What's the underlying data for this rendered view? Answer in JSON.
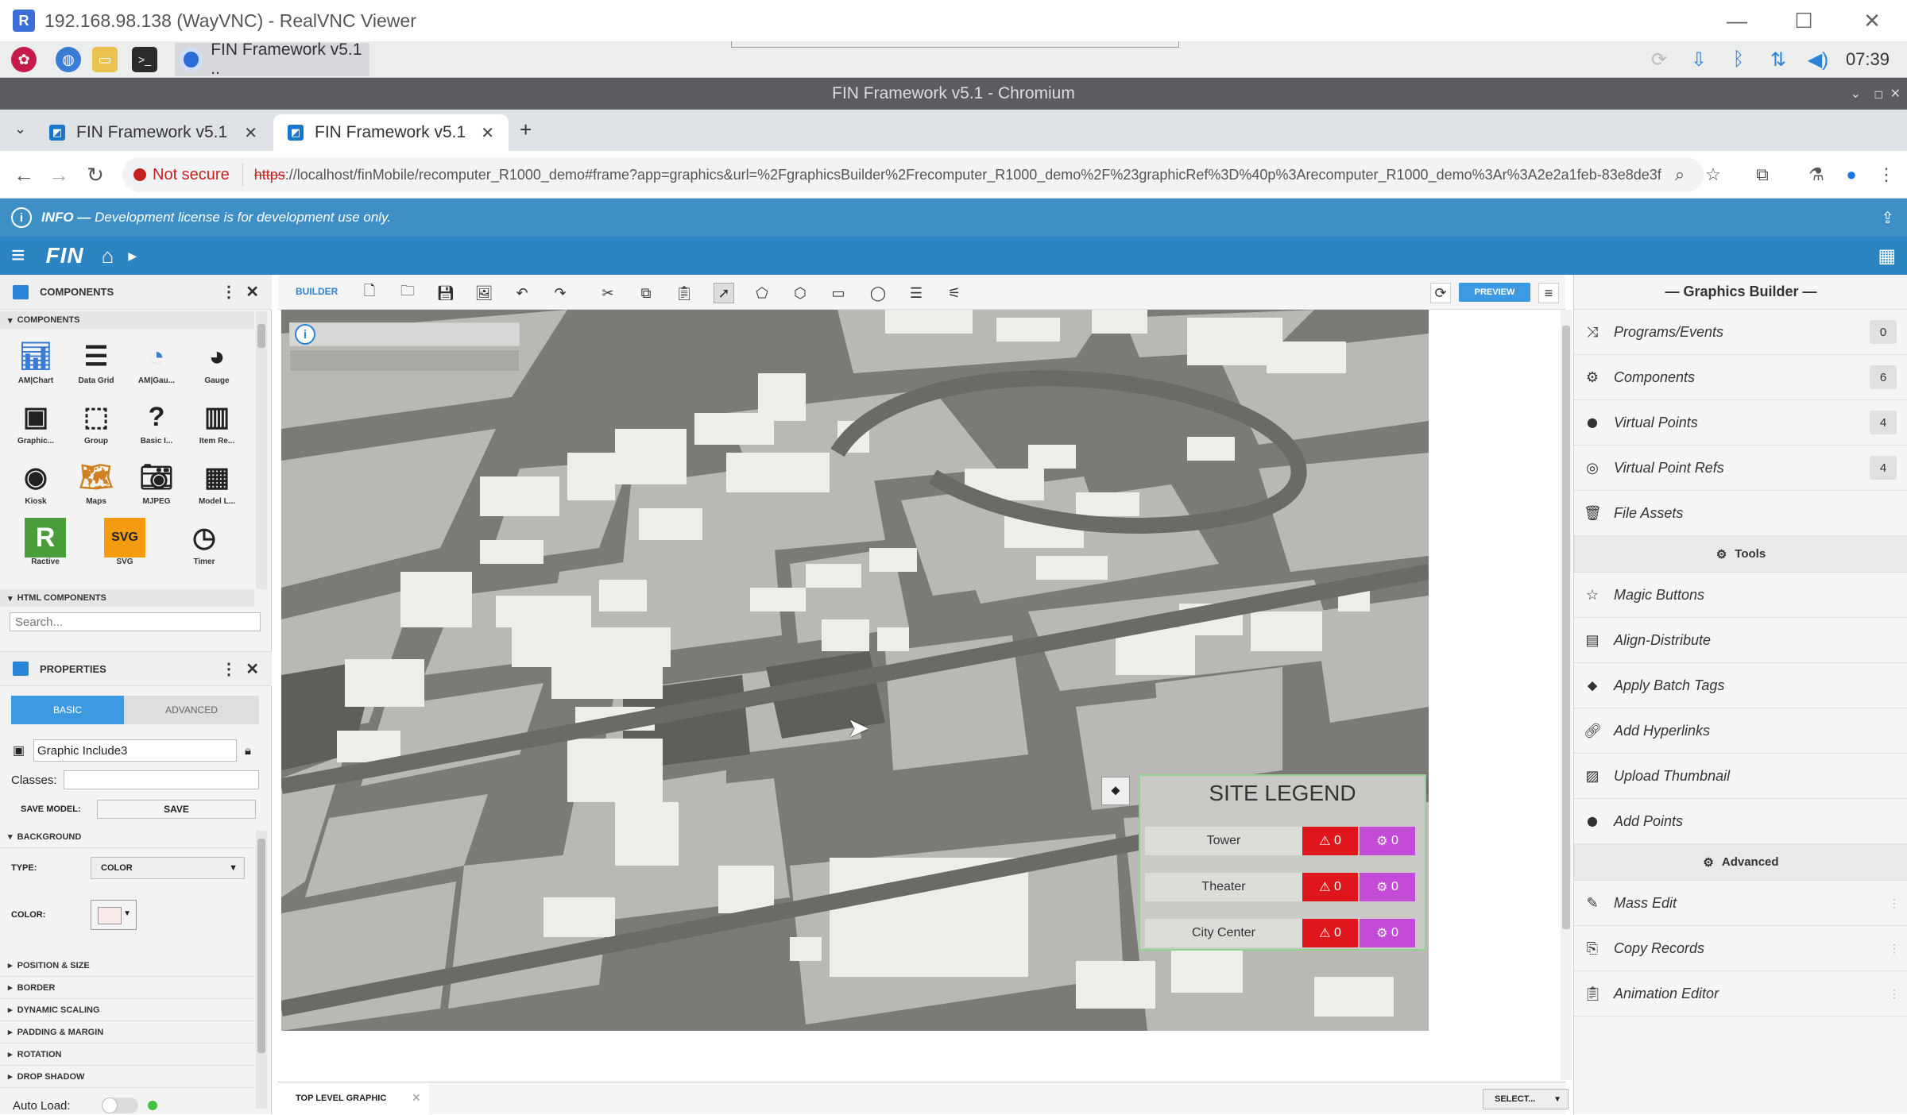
{
  "vnc": {
    "title": "192.168.98.138 (WayVNC) - RealVNC Viewer",
    "logo": "R"
  },
  "taskbar": {
    "task_label": "FIN Framework v5.1 ..",
    "clock": "07:39"
  },
  "chrome": {
    "window_title": "FIN Framework v5.1 - Chromium",
    "tabs": [
      {
        "label": "FIN Framework v5.1"
      },
      {
        "label": "FIN Framework v5.1"
      }
    ],
    "not_secure": "Not secure",
    "url_scheme": "https",
    "url_rest": "://localhost/finMobile/recomputer_R1000_demo#frame?app=graphics&url=%2FgraphicsBuilder%2Frecomputer_R1000_demo%2F%23graphicRef%3D%40p%3Arecomputer_R1000_demo%3Ar%3A2e2a1feb-83e8de3f"
  },
  "infobar": {
    "label": "INFO —",
    "message": "Development license is for development use only."
  },
  "finbar": {
    "brand": "FIN"
  },
  "components_panel": {
    "title": "COMPONENTS",
    "section": "COMPONENTS",
    "items": [
      {
        "label": "AM|Chart",
        "icon": "chart-icon"
      },
      {
        "label": "Data Grid",
        "icon": "grid-icon"
      },
      {
        "label": "AM|Gau...",
        "icon": "amgauge-icon"
      },
      {
        "label": "Gauge",
        "icon": "gauge-icon"
      },
      {
        "label": "Graphic...",
        "icon": "graphic-icon"
      },
      {
        "label": "Group",
        "icon": "group-icon"
      },
      {
        "label": "Basic I...",
        "icon": "help-icon"
      },
      {
        "label": "Item Re...",
        "icon": "item-repeater-icon"
      },
      {
        "label": "Kiosk",
        "icon": "kiosk-icon"
      },
      {
        "label": "Maps",
        "icon": "maps-icon"
      },
      {
        "label": "MJPEG",
        "icon": "camera-icon"
      },
      {
        "label": "Model L...",
        "icon": "model-icon"
      },
      {
        "label": "Ractive",
        "icon": "ractive-icon"
      },
      {
        "label": "SVG",
        "icon": "svg-icon"
      },
      {
        "label": "Timer",
        "icon": "timer-icon"
      }
    ],
    "html_section": "HTML COMPONENTS",
    "search_placeholder": "Search..."
  },
  "properties_panel": {
    "title": "PROPERTIES",
    "tab_basic": "BASIC",
    "tab_advanced": "ADVANCED",
    "name_value": "Graphic Include3",
    "classes_label": "Classes:",
    "save_model_label": "SAVE MODEL:",
    "save_button": "SAVE",
    "background_section": "BACKGROUND",
    "type_label": "TYPE:",
    "type_value": "COLOR",
    "color_label": "COLOR:",
    "sections": [
      "POSITION & SIZE",
      "BORDER",
      "DYNAMIC SCALING",
      "PADDING & MARGIN",
      "ROTATION",
      "DROP SHADOW"
    ],
    "auto_load_label": "Auto Load:"
  },
  "builder": {
    "label": "BUILDER",
    "preview_button": "PREVIEW",
    "bottom_tab": "TOP LEVEL GRAPHIC",
    "select_label": "SELECT..."
  },
  "legend": {
    "title": "SITE LEGEND",
    "rows": [
      {
        "name": "Tower",
        "alarms": "0",
        "other": "0"
      },
      {
        "name": "Theater",
        "alarms": "0",
        "other": "0"
      },
      {
        "name": "City Center",
        "alarms": "0",
        "other": "0"
      }
    ]
  },
  "graphics_builder": {
    "title": "— Graphics Builder —",
    "items": [
      {
        "label": "Programs/Events",
        "icon": "shuffle-icon",
        "badge": "0"
      },
      {
        "label": "Components",
        "icon": "gear-icon",
        "badge": "6"
      },
      {
        "label": "Virtual Points",
        "icon": "pin-icon",
        "badge": "4"
      },
      {
        "label": "Virtual Point Refs",
        "icon": "pin-outline-icon",
        "badge": "4"
      },
      {
        "label": "File Assets",
        "icon": "trash-icon",
        "badge": ""
      }
    ],
    "tools_section": "Tools",
    "tools": [
      {
        "label": "Magic Buttons",
        "icon": "star-icon"
      },
      {
        "label": "Align-Distribute",
        "icon": "align-icon"
      },
      {
        "label": "Apply Batch Tags",
        "icon": "tag-icon"
      },
      {
        "label": "Add Hyperlinks",
        "icon": "link-icon"
      },
      {
        "label": "Upload Thumbnail",
        "icon": "image-icon"
      },
      {
        "label": "Add Points",
        "icon": "pin-icon"
      }
    ],
    "advanced_section": "Advanced",
    "advanced": [
      {
        "label": "Mass Edit",
        "icon": "edit-icon"
      },
      {
        "label": "Copy Records",
        "icon": "copy-icon"
      },
      {
        "label": "Animation Editor",
        "icon": "clipboard-icon"
      }
    ]
  }
}
